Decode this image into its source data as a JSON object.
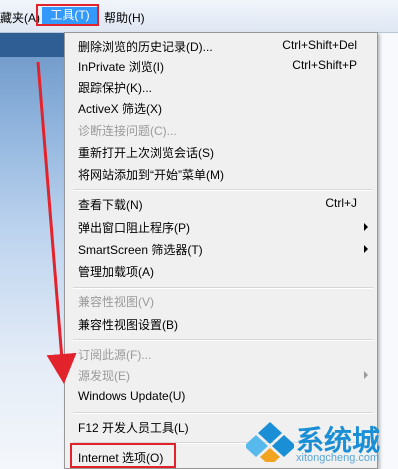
{
  "menubar": {
    "favorites": "藏夹(A)",
    "tools": "工具(T)",
    "help": "帮助(H)"
  },
  "menu": {
    "items": [
      {
        "label": "删除浏览的历史记录(D)...",
        "shortcut": "Ctrl+Shift+Del"
      },
      {
        "label": "InPrivate 浏览(I)",
        "shortcut": "Ctrl+Shift+P"
      },
      {
        "label": "跟踪保护(K)..."
      },
      {
        "label": "ActiveX 筛选(X)"
      },
      {
        "label": "诊断连接问题(C)...",
        "disabled": true
      },
      {
        "label": "重新打开上次浏览会话(S)"
      },
      {
        "label": "将网站添加到“开始”菜单(M)"
      },
      {
        "label": "查看下载(N)",
        "shortcut": "Ctrl+J"
      },
      {
        "label": "弹出窗口阻止程序(P)",
        "submenu": true
      },
      {
        "label": "SmartScreen 筛选器(T)",
        "submenu": true
      },
      {
        "label": "管理加载项(A)"
      },
      {
        "label": "兼容性视图(V)",
        "disabled": true
      },
      {
        "label": "兼容性视图设置(B)"
      },
      {
        "label": "订阅此源(F)...",
        "disabled": true
      },
      {
        "label": "源发现(E)",
        "disabled": true,
        "submenu": true
      },
      {
        "label": "Windows Update(U)"
      },
      {
        "label": "F12 开发人员工具(L)"
      },
      {
        "label": "Internet 选项(O)"
      }
    ]
  },
  "watermark": {
    "brand": "系统城",
    "url": "xitongcheng.com"
  },
  "colors": {
    "highlight_box": "#e3232c",
    "annotation_arrow": "#e3232c",
    "menu_selected": "#3399ff",
    "watermark": "#1a8fd6"
  }
}
